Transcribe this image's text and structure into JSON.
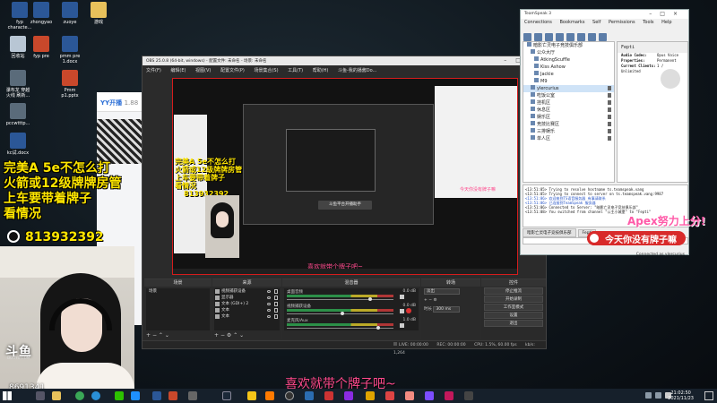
{
  "desktop": {
    "icons": [
      {
        "label": "fyp\ncharacte...",
        "kind": "word"
      },
      {
        "label": "zhongyao",
        "kind": "word"
      },
      {
        "label": "zuoye",
        "kind": "word"
      },
      {
        "label": "游戏",
        "kind": "folder"
      },
      {
        "label": "回收站",
        "kind": "bin"
      },
      {
        "label": "fyp pre",
        "kind": "ppt"
      },
      {
        "label": "pmm pre\n1.docx",
        "kind": "word"
      },
      {
        "label": "瀑布龙 穿越\n火线 刷新...",
        "kind": "app"
      },
      {
        "label": "Pmm\np1.pptx",
        "kind": "ppt"
      },
      {
        "label": "pccwtttp...",
        "kind": "app"
      },
      {
        "label": "kc试.docx",
        "kind": "word"
      }
    ]
  },
  "yy": {
    "logo": "YY开播",
    "version": "1.88"
  },
  "overlay": {
    "lines": [
      "完美A  5e不怎么打",
      "火箭或12级牌牌房管",
      "上车要带着牌子",
      "看情况"
    ],
    "qq_number": "813932392",
    "bottom_caption": "喜欢就带个牌子吧~",
    "apex_text": "Apex努力上分!",
    "ribbon_text": "今天你没有牌子嘛",
    "douyu_logo": "斗鱼",
    "douyu_sub": "DOUYU.COM",
    "room_number": "8691341"
  },
  "obs": {
    "title": "OBS 25.0.8 (64-bit, windows) - 配置文件: 未命名 - 场景: 未命名",
    "menu": [
      "文件(F)",
      "编辑(E)",
      "视图(V)",
      "配置文件(P)",
      "场景集合(S)",
      "工具(T)",
      "帮助(H)",
      "斗鱼-我的播酱Do..."
    ],
    "preview": {
      "overlay_lines": [
        "完美A 5e不怎么打",
        "火箭或12级牌牌房管",
        "上车要带着牌子",
        "看情况"
      ],
      "qq_number": "813932392",
      "caption": "喜欢就带个牌子吧~",
      "center_button": "斗鱼平台开播助手",
      "side_caption": "今天你没有牌子嘛"
    },
    "docks": {
      "scenes": {
        "title": "场景",
        "items": [
          "场景"
        ]
      },
      "sources": {
        "title": "来源",
        "items": [
          "视频捕获设备",
          "显示器",
          "文本 (GDI+) 2",
          "文本",
          "文本"
        ]
      },
      "mixer": {
        "title": "混音器",
        "channels": [
          {
            "name": "桌面音频",
            "db": "0.0 dB",
            "level": 0.78
          },
          {
            "name": "视频捕获设备",
            "db": "0.0 dB",
            "level": 0.52
          },
          {
            "name": "麦克风/Aux",
            "db": "1.0 dB",
            "level": 0.86
          }
        ]
      },
      "transitions": {
        "title": "转场",
        "type": "淡出",
        "duration_label": "时长",
        "duration": "300 ms"
      },
      "controls": {
        "title": "控件",
        "buttons": [
          "停止推流",
          "开始录制",
          "工作室模式",
          "设置",
          "退出"
        ]
      }
    },
    "status": {
      "dropped": "LIVE: 00:00:00",
      "rec": "REC: 00:00:00",
      "cpu": "CPU: 1.5%, 60.00 fps",
      "kbps": "kb/s: 1,264"
    }
  },
  "teamspeak": {
    "title": "TeamSpeak 3",
    "menu": [
      "Connections",
      "Bookmarks",
      "Self",
      "Permissions",
      "Tools",
      "Help"
    ],
    "tree": [
      "暗影亡灵电子竞技俱乐部",
      "公众大厅",
      "AtkingScuffle",
      "Kiss Ashow",
      "Jackie",
      "M9",
      "ylercurius",
      "吃饭公室",
      "挂机区",
      "休息区",
      "娱乐区",
      "竞技比赛区",
      "三排娱乐",
      "单人区"
    ],
    "info": {
      "heading": "Fepti",
      "rows": [
        {
          "key": "Audio Codec:",
          "value": "Opus Voice"
        },
        {
          "key": "Properties:",
          "value": "Permanent"
        },
        {
          "key": "Current Clients:",
          "value": "1 / Unlimited"
        }
      ]
    },
    "chat": [
      "<13:51:05> Trying to resolve hostname ts.teamspeak.vang",
      "<13:51:05> Trying to connect to server on ts.teamspeak.vang:9987",
      "<13:51:06> 欢迎来到TS语音服务器 有事请联系",
      "<13:51:06> 已连接到TeamSpeak 服务器",
      "<13:51:06> Connected to Server: \"暗影亡灵电子竞技俱乐部\"",
      "<13:51:08> You switched from channel \"公主小城堡\" to \"Fepti\""
    ],
    "tabs": [
      "暗影亡灵电子竞技俱乐部",
      "Fepti"
    ],
    "status": {
      "left": "",
      "right": "Connected as ylercurius"
    }
  },
  "taskbar": {
    "time": "21:02:50",
    "date": "2021/11/23"
  },
  "colors": {
    "overlay_yellow": "#ffe600",
    "caption_pink": "#ff4a8d",
    "preview_border": "#d51c1c"
  }
}
